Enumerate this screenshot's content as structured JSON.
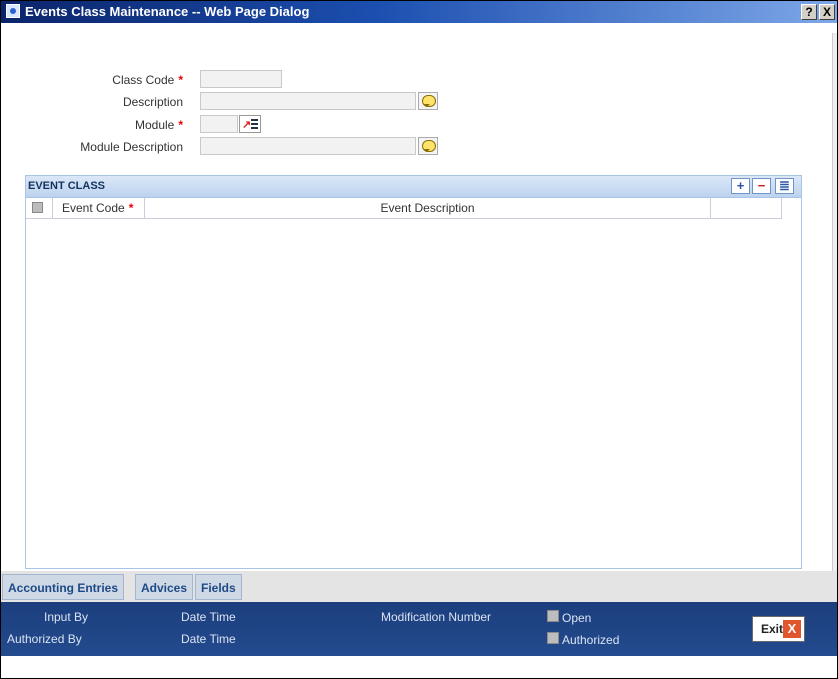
{
  "window": {
    "title": "Events Class Maintenance -- Web Page Dialog",
    "help_btn": "?",
    "close_btn": "X"
  },
  "form": {
    "class_code_label": "Class Code",
    "description_label": "Description",
    "module_label": "Module",
    "module_description_label": "Module Description",
    "required_mark": "*",
    "class_code_value": "",
    "description_value": "",
    "module_value": "",
    "module_description_value": ""
  },
  "event_class": {
    "title": "EVENT CLASS",
    "add_btn": "+",
    "remove_btn": "−",
    "view_btn": "≣",
    "columns": [
      "Event Code",
      "Event Description"
    ],
    "rows": []
  },
  "tabs": [
    "Accounting Entries",
    "Advices",
    "Fields"
  ],
  "footer": {
    "input_by": "Input By",
    "authorized_by": "Authorized By",
    "date_time_1": "Date Time",
    "date_time_2": "Date Time",
    "modification_number": "Modification Number",
    "open": "Open",
    "authorized": "Authorized",
    "exit": "Exit",
    "exit_icon": "X"
  },
  "colors": {
    "title_bar": "#0a246a",
    "footer": "#1c3e7d",
    "grid_header": "#bcd2ee",
    "required": "#e00000",
    "exit_icon": "#e2562e"
  }
}
